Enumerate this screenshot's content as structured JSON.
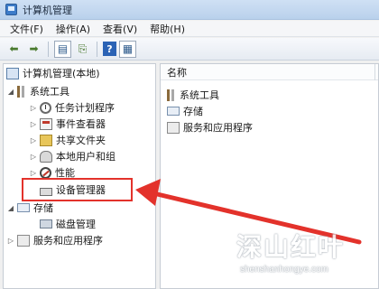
{
  "window": {
    "title": "计算机管理"
  },
  "menu": [
    {
      "label": "文件(F)"
    },
    {
      "label": "操作(A)"
    },
    {
      "label": "查看(V)"
    },
    {
      "label": "帮助(H)"
    }
  ],
  "toolbar": {
    "back_icon": "back-arrow-icon",
    "forward_icon": "forward-arrow-icon",
    "help_label": "?"
  },
  "tree": {
    "root": "计算机管理(本地)",
    "system_tools": "系统工具",
    "task_scheduler": "任务计划程序",
    "event_viewer": "事件查看器",
    "shared_folders": "共享文件夹",
    "local_users": "本地用户和组",
    "performance": "性能",
    "device_manager": "设备管理器",
    "storage": "存储",
    "disk_management": "磁盘管理",
    "services_apps": "服务和应用程序"
  },
  "detail": {
    "column_name": "名称",
    "items": [
      {
        "label": "系统工具"
      },
      {
        "label": "存储"
      },
      {
        "label": "服务和应用程序"
      }
    ]
  },
  "annotation": {
    "highlight_color": "#e3322b",
    "arrow_color": "#e3322b"
  },
  "watermark": {
    "main": "深山红叶",
    "sub": "shenshanhongye.com"
  }
}
